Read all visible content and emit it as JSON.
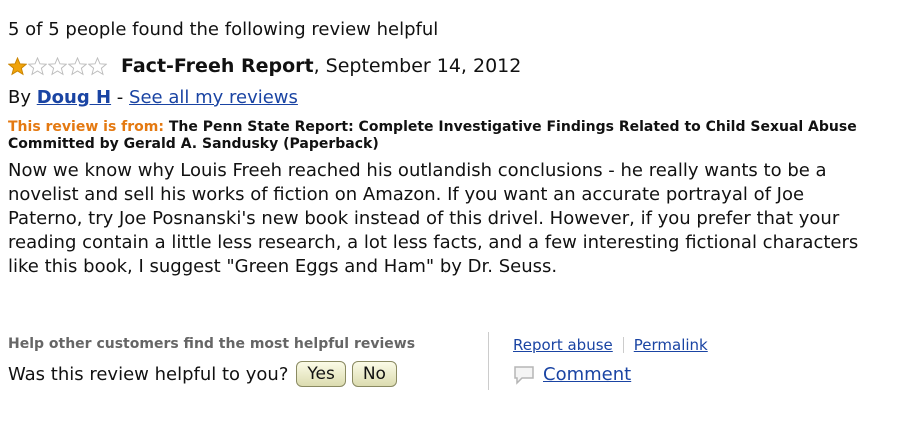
{
  "review": {
    "helpful_count": "5 of 5 people found the following review helpful",
    "rating": {
      "value": 1,
      "max": 5
    },
    "title": "Fact-Freeh Report",
    "date": ", September 14, 2012",
    "by_prefix": "By ",
    "author": "Doug H",
    "dash": " - ",
    "see_all_link": "See all my reviews",
    "from_label": "This review is from:",
    "product": "The Penn State Report: Complete Investigative Findings Related to Child Sexual Abuse Committed by Gerald A. Sandusky (Paperback)",
    "body": "Now we know why Louis Freeh reached his outlandish conclusions - he really wants to be a novelist and sell his works of fiction on Amazon. If you want an accurate portrayal of Joe Paterno, try Joe Posnanski's new book instead of this drivel. However, if you prefer that your reading contain a little less research, a lot less facts, and a few interesting fictional characters like this book, I suggest \"Green Eggs and Ham\" by Dr. Seuss."
  },
  "footer": {
    "help_others": "Help other customers find the most helpful reviews",
    "question": "Was this review helpful to you?",
    "yes_label": "Yes",
    "no_label": "No",
    "report_abuse": "Report abuse",
    "permalink": "Permalink",
    "comment": "Comment",
    "comment_icon": "speech-bubble-icon"
  },
  "colors": {
    "link": "#1a44a3",
    "from_label": "#e47911",
    "star_filled": "#f0a30a",
    "star_empty": "#bdbdbd"
  }
}
